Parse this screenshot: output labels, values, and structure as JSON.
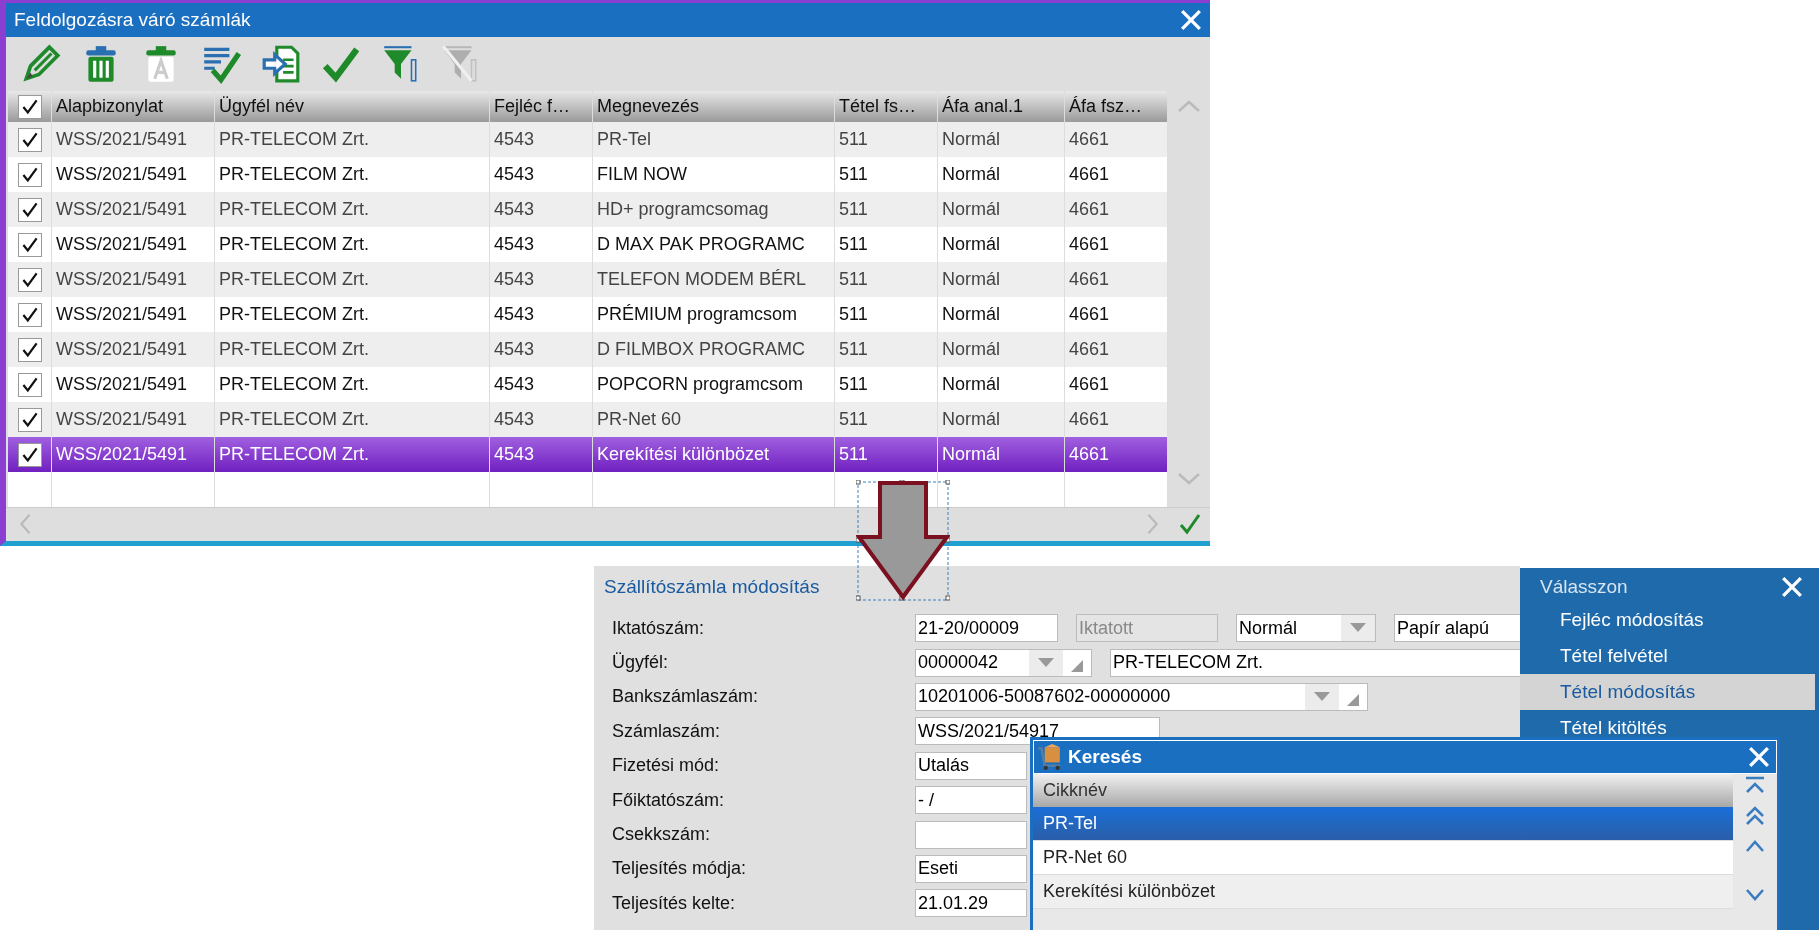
{
  "main_window": {
    "title": "Feldolgozásra váró számlák",
    "toolbar": [
      {
        "kind": "edit",
        "disabled": false
      },
      {
        "kind": "delete",
        "disabled": false
      },
      {
        "kind": "delete-text",
        "disabled": false
      },
      {
        "kind": "check-list",
        "disabled": false
      },
      {
        "kind": "import",
        "disabled": false
      },
      {
        "kind": "confirm",
        "disabled": false
      },
      {
        "kind": "filter",
        "disabled": false
      },
      {
        "kind": "clear-filter",
        "disabled": true
      }
    ],
    "grid": {
      "header_checked": true,
      "columns": [
        "Alapbizonylat",
        "Ügyfél név",
        "Fejléc f…",
        "Megnevezés",
        "Tétel fs…",
        "Áfa anal.1",
        "Áfa fsz…"
      ],
      "rows": [
        {
          "checked": true,
          "selected": false,
          "cells": [
            "WSS/2021/5491",
            "PR-TELECOM Zrt.",
            "4543",
            "PR-Tel",
            "511",
            "Normál",
            "4661"
          ]
        },
        {
          "checked": true,
          "selected": false,
          "cells": [
            "WSS/2021/5491",
            "PR-TELECOM Zrt.",
            "4543",
            "FILM NOW",
            "511",
            "Normál",
            "4661"
          ]
        },
        {
          "checked": true,
          "selected": false,
          "cells": [
            "WSS/2021/5491",
            "PR-TELECOM Zrt.",
            "4543",
            "HD+ programcsomag",
            "511",
            "Normál",
            "4661"
          ]
        },
        {
          "checked": true,
          "selected": false,
          "cells": [
            "WSS/2021/5491",
            "PR-TELECOM Zrt.",
            "4543",
            "D MAX PAK PROGRAMC",
            "511",
            "Normál",
            "4661"
          ]
        },
        {
          "checked": true,
          "selected": false,
          "cells": [
            "WSS/2021/5491",
            "PR-TELECOM Zrt.",
            "4543",
            "TELEFON MODEM BÉRL",
            "511",
            "Normál",
            "4661"
          ]
        },
        {
          "checked": true,
          "selected": false,
          "cells": [
            "WSS/2021/5491",
            "PR-TELECOM Zrt.",
            "4543",
            "PRÉMIUM programcsom",
            "511",
            "Normál",
            "4661"
          ]
        },
        {
          "checked": true,
          "selected": false,
          "cells": [
            "WSS/2021/5491",
            "PR-TELECOM Zrt.",
            "4543",
            "D FILMBOX PROGRAMC",
            "511",
            "Normál",
            "4661"
          ]
        },
        {
          "checked": true,
          "selected": false,
          "cells": [
            "WSS/2021/5491",
            "PR-TELECOM Zrt.",
            "4543",
            "POPCORN programcsom",
            "511",
            "Normál",
            "4661"
          ]
        },
        {
          "checked": true,
          "selected": false,
          "cells": [
            "WSS/2021/5491",
            "PR-TELECOM Zrt.",
            "4543",
            "PR-Net 60",
            "511",
            "Normál",
            "4661"
          ]
        },
        {
          "checked": true,
          "selected": true,
          "cells": [
            "WSS/2021/5491",
            "PR-TELECOM Zrt.",
            "4543",
            "Kerekítési különbözet",
            "511",
            "Normál",
            "4661"
          ]
        }
      ]
    }
  },
  "form": {
    "title": "Szállítószámla módosítás",
    "fields": [
      {
        "label": "Iktatószám:",
        "inputs": [
          {
            "kind": "text",
            "value": "21-20/00009"
          },
          {
            "kind": "readonly",
            "value": "Iktatott"
          },
          {
            "kind": "select",
            "value": "Normál"
          },
          {
            "kind": "text",
            "value": "Papír alapú"
          }
        ]
      },
      {
        "label": "Ügyfél:",
        "inputs": [
          {
            "kind": "combo",
            "value": "00000042"
          },
          {
            "kind": "text",
            "value": "PR-TELECOM Zrt."
          }
        ]
      },
      {
        "label": "Bankszámlaszám:",
        "inputs": [
          {
            "kind": "combo",
            "value": "10201006-50087602-00000000"
          }
        ]
      },
      {
        "label": "Számlaszám:",
        "inputs": [
          {
            "kind": "text",
            "value": "WSS/2021/54917"
          }
        ]
      },
      {
        "label": "Fizetési mód:",
        "inputs": [
          {
            "kind": "text",
            "value": "Utalás"
          }
        ]
      },
      {
        "label": "Főiktatószám:",
        "inputs": [
          {
            "kind": "text",
            "value": "-  /"
          }
        ]
      },
      {
        "label": "Csekkszám:",
        "inputs": [
          {
            "kind": "text"
          }
        ]
      },
      {
        "label": "Teljesítés módja:",
        "inputs": [
          {
            "kind": "text",
            "value": "Eseti"
          }
        ]
      },
      {
        "label": "Teljesítés kelte:",
        "inputs": [
          {
            "kind": "text",
            "value": "21.01.29"
          }
        ]
      }
    ]
  },
  "menu": {
    "title": "Válasszon",
    "items": [
      {
        "label": "Fejléc módosítás",
        "selected": false
      },
      {
        "label": "Tétel felvétel",
        "selected": false
      },
      {
        "label": "Tétel módosítás",
        "selected": true
      },
      {
        "label": "Tétel kitöltés",
        "selected": false
      }
    ]
  },
  "search_window": {
    "title": "Keresés",
    "column": "Cikknév",
    "rows": [
      {
        "label": "PR-Tel",
        "selected": true
      },
      {
        "label": "PR-Net 60",
        "selected": false
      },
      {
        "label": "Kerekítési különbözet",
        "selected": false
      }
    ]
  }
}
